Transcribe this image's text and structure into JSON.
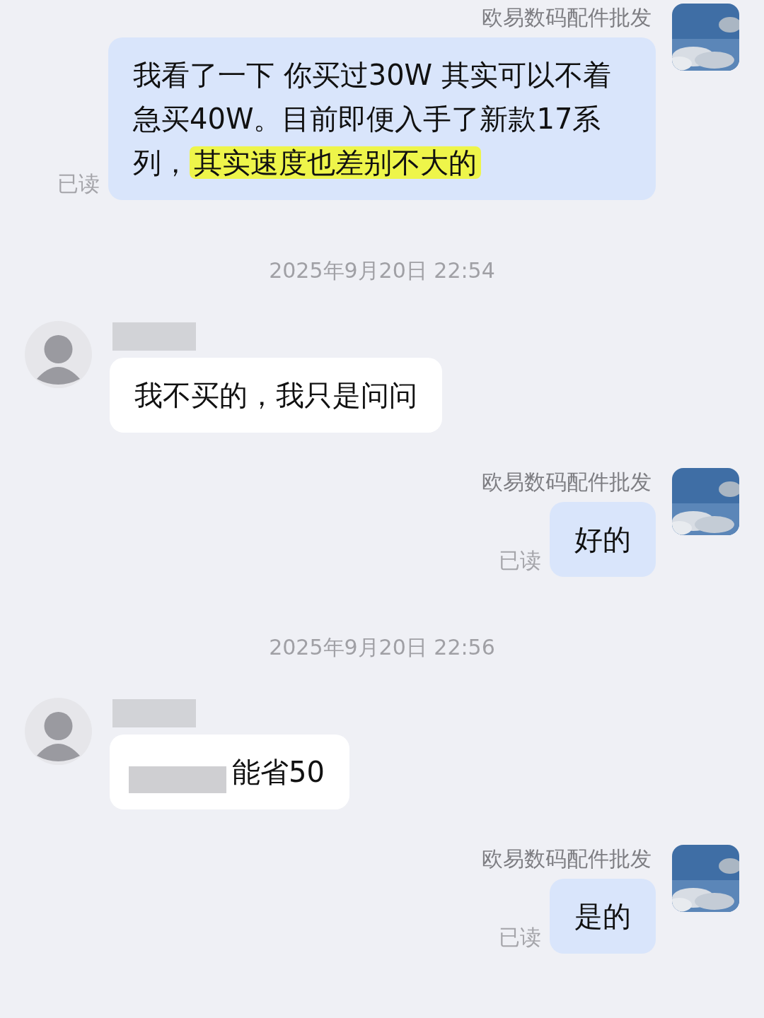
{
  "messages": [
    {
      "kind": "outgoing",
      "sender": "欧易数码配件批发",
      "read_label": "已读",
      "segments": [
        {
          "text": "我看了一下 你买过30W 其实可以不着急买40W。目前即便入手了新款17系列，"
        },
        {
          "text": "其实速度也差别不大的",
          "highlighted": true
        }
      ]
    },
    {
      "kind": "timestamp",
      "text": "2025年9月20日 22:54"
    },
    {
      "kind": "incoming",
      "segments": [
        {
          "text": "我不买的，我只是问问"
        }
      ]
    },
    {
      "kind": "outgoing",
      "sender": "欧易数码配件批发",
      "read_label": "已读",
      "segments": [
        {
          "text": "好的"
        }
      ]
    },
    {
      "kind": "timestamp",
      "text": "2025年9月20日 22:56"
    },
    {
      "kind": "incoming",
      "redacted": true,
      "segments": [
        {
          "text": "能省50"
        }
      ]
    },
    {
      "kind": "outgoing",
      "sender": "欧易数码配件批发",
      "read_label": "已读",
      "segments": [
        {
          "text": "是的"
        }
      ]
    }
  ]
}
